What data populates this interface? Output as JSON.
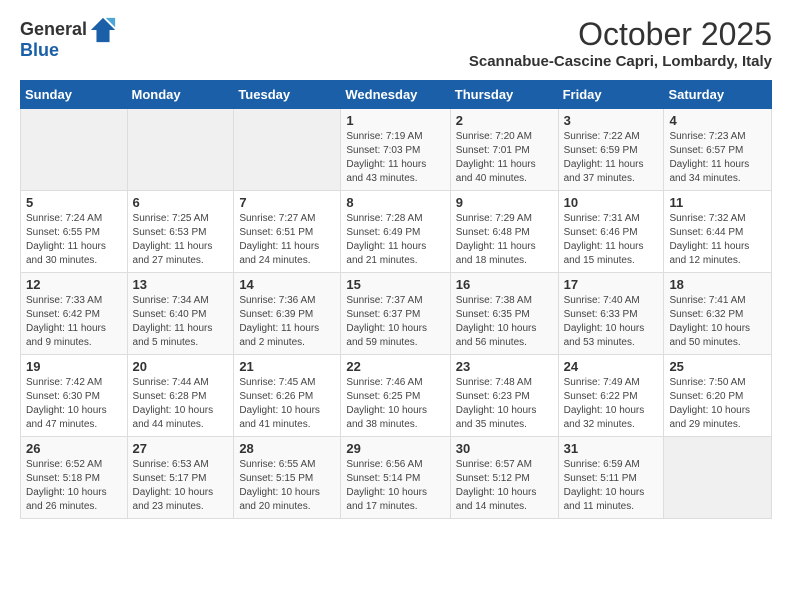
{
  "header": {
    "logo_general": "General",
    "logo_blue": "Blue",
    "month": "October 2025",
    "location": "Scannabue-Cascine Capri, Lombardy, Italy"
  },
  "days_of_week": [
    "Sunday",
    "Monday",
    "Tuesday",
    "Wednesday",
    "Thursday",
    "Friday",
    "Saturday"
  ],
  "weeks": [
    [
      {
        "day": "",
        "info": ""
      },
      {
        "day": "",
        "info": ""
      },
      {
        "day": "",
        "info": ""
      },
      {
        "day": "1",
        "info": "Sunrise: 7:19 AM\nSunset: 7:03 PM\nDaylight: 11 hours and 43 minutes."
      },
      {
        "day": "2",
        "info": "Sunrise: 7:20 AM\nSunset: 7:01 PM\nDaylight: 11 hours and 40 minutes."
      },
      {
        "day": "3",
        "info": "Sunrise: 7:22 AM\nSunset: 6:59 PM\nDaylight: 11 hours and 37 minutes."
      },
      {
        "day": "4",
        "info": "Sunrise: 7:23 AM\nSunset: 6:57 PM\nDaylight: 11 hours and 34 minutes."
      }
    ],
    [
      {
        "day": "5",
        "info": "Sunrise: 7:24 AM\nSunset: 6:55 PM\nDaylight: 11 hours and 30 minutes."
      },
      {
        "day": "6",
        "info": "Sunrise: 7:25 AM\nSunset: 6:53 PM\nDaylight: 11 hours and 27 minutes."
      },
      {
        "day": "7",
        "info": "Sunrise: 7:27 AM\nSunset: 6:51 PM\nDaylight: 11 hours and 24 minutes."
      },
      {
        "day": "8",
        "info": "Sunrise: 7:28 AM\nSunset: 6:49 PM\nDaylight: 11 hours and 21 minutes."
      },
      {
        "day": "9",
        "info": "Sunrise: 7:29 AM\nSunset: 6:48 PM\nDaylight: 11 hours and 18 minutes."
      },
      {
        "day": "10",
        "info": "Sunrise: 7:31 AM\nSunset: 6:46 PM\nDaylight: 11 hours and 15 minutes."
      },
      {
        "day": "11",
        "info": "Sunrise: 7:32 AM\nSunset: 6:44 PM\nDaylight: 11 hours and 12 minutes."
      }
    ],
    [
      {
        "day": "12",
        "info": "Sunrise: 7:33 AM\nSunset: 6:42 PM\nDaylight: 11 hours and 9 minutes."
      },
      {
        "day": "13",
        "info": "Sunrise: 7:34 AM\nSunset: 6:40 PM\nDaylight: 11 hours and 5 minutes."
      },
      {
        "day": "14",
        "info": "Sunrise: 7:36 AM\nSunset: 6:39 PM\nDaylight: 11 hours and 2 minutes."
      },
      {
        "day": "15",
        "info": "Sunrise: 7:37 AM\nSunset: 6:37 PM\nDaylight: 10 hours and 59 minutes."
      },
      {
        "day": "16",
        "info": "Sunrise: 7:38 AM\nSunset: 6:35 PM\nDaylight: 10 hours and 56 minutes."
      },
      {
        "day": "17",
        "info": "Sunrise: 7:40 AM\nSunset: 6:33 PM\nDaylight: 10 hours and 53 minutes."
      },
      {
        "day": "18",
        "info": "Sunrise: 7:41 AM\nSunset: 6:32 PM\nDaylight: 10 hours and 50 minutes."
      }
    ],
    [
      {
        "day": "19",
        "info": "Sunrise: 7:42 AM\nSunset: 6:30 PM\nDaylight: 10 hours and 47 minutes."
      },
      {
        "day": "20",
        "info": "Sunrise: 7:44 AM\nSunset: 6:28 PM\nDaylight: 10 hours and 44 minutes."
      },
      {
        "day": "21",
        "info": "Sunrise: 7:45 AM\nSunset: 6:26 PM\nDaylight: 10 hours and 41 minutes."
      },
      {
        "day": "22",
        "info": "Sunrise: 7:46 AM\nSunset: 6:25 PM\nDaylight: 10 hours and 38 minutes."
      },
      {
        "day": "23",
        "info": "Sunrise: 7:48 AM\nSunset: 6:23 PM\nDaylight: 10 hours and 35 minutes."
      },
      {
        "day": "24",
        "info": "Sunrise: 7:49 AM\nSunset: 6:22 PM\nDaylight: 10 hours and 32 minutes."
      },
      {
        "day": "25",
        "info": "Sunrise: 7:50 AM\nSunset: 6:20 PM\nDaylight: 10 hours and 29 minutes."
      }
    ],
    [
      {
        "day": "26",
        "info": "Sunrise: 6:52 AM\nSunset: 5:18 PM\nDaylight: 10 hours and 26 minutes."
      },
      {
        "day": "27",
        "info": "Sunrise: 6:53 AM\nSunset: 5:17 PM\nDaylight: 10 hours and 23 minutes."
      },
      {
        "day": "28",
        "info": "Sunrise: 6:55 AM\nSunset: 5:15 PM\nDaylight: 10 hours and 20 minutes."
      },
      {
        "day": "29",
        "info": "Sunrise: 6:56 AM\nSunset: 5:14 PM\nDaylight: 10 hours and 17 minutes."
      },
      {
        "day": "30",
        "info": "Sunrise: 6:57 AM\nSunset: 5:12 PM\nDaylight: 10 hours and 14 minutes."
      },
      {
        "day": "31",
        "info": "Sunrise: 6:59 AM\nSunset: 5:11 PM\nDaylight: 10 hours and 11 minutes."
      },
      {
        "day": "",
        "info": ""
      }
    ]
  ]
}
